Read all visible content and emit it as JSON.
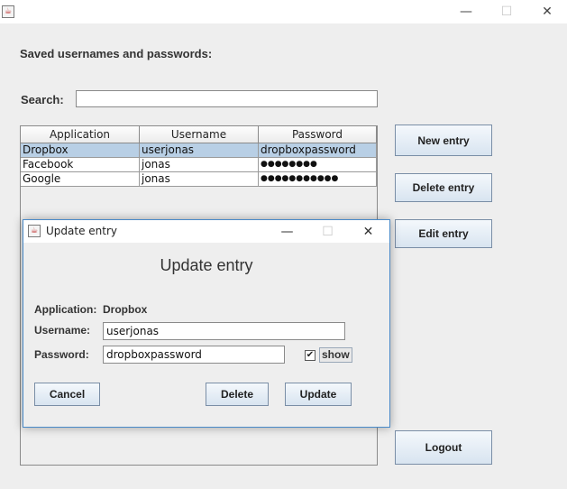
{
  "window": {
    "app_icon": "java-icon",
    "minimize_glyph": "—",
    "maximize_glyph": "☐",
    "close_glyph": "✕"
  },
  "main": {
    "heading": "Saved usernames and passwords:",
    "search_label": "Search:",
    "search_value": "",
    "table": {
      "columns": [
        "Application",
        "Username",
        "Password"
      ],
      "rows": [
        {
          "application": "Dropbox",
          "username": "userjonas",
          "password": "dropboxpassword",
          "selected": true
        },
        {
          "application": "Facebook",
          "username": "jonas",
          "password": "●●●●●●●●",
          "selected": false
        },
        {
          "application": "Google",
          "username": "jonas",
          "password": "●●●●●●●●●●●",
          "selected": false
        }
      ]
    },
    "buttons": {
      "new_entry": "New entry",
      "delete_entry": "Delete entry",
      "edit_entry": "Edit entry",
      "logout": "Logout"
    }
  },
  "dialog": {
    "window_title": "Update entry",
    "heading": "Update entry",
    "application_label": "Application:",
    "application_value": "Dropbox",
    "username_label": "Username:",
    "username_value": "userjonas",
    "password_label": "Password:",
    "password_value": "dropboxpassword",
    "show_checked": true,
    "show_label": "show",
    "checkbox_glyph": "✔",
    "buttons": {
      "cancel": "Cancel",
      "delete": "Delete",
      "update": "Update"
    }
  },
  "colors": {
    "selection": "#b8cfe5",
    "dialog_border": "#4a8ac8"
  }
}
